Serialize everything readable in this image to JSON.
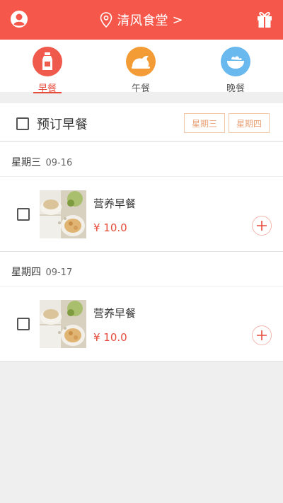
{
  "header": {
    "location": "清风食堂",
    "arrow": ">"
  },
  "meal_tabs": [
    {
      "label": "早餐",
      "icon": "milk-bottle-icon",
      "color": "#ef5a4c",
      "active": true
    },
    {
      "label": "午餐",
      "icon": "roast-chicken-icon",
      "color": "#f39c35",
      "active": false
    },
    {
      "label": "晚餐",
      "icon": "bowl-icon",
      "color": "#69b9ee",
      "active": false
    }
  ],
  "order": {
    "title": "预订早餐",
    "days": [
      "星期三",
      "星期四"
    ]
  },
  "sections": [
    {
      "day": "星期三",
      "date": "09-16",
      "item": {
        "name": "营养早餐",
        "price": "¥ 10.0"
      }
    },
    {
      "day": "星期四",
      "date": "09-17",
      "item": {
        "name": "营养早餐",
        "price": "¥ 10.0"
      }
    }
  ],
  "colors": {
    "accent": "#f5574a",
    "price": "#e64c3c",
    "day_button_border": "#f3c6a5",
    "day_button_text": "#e8a074"
  }
}
